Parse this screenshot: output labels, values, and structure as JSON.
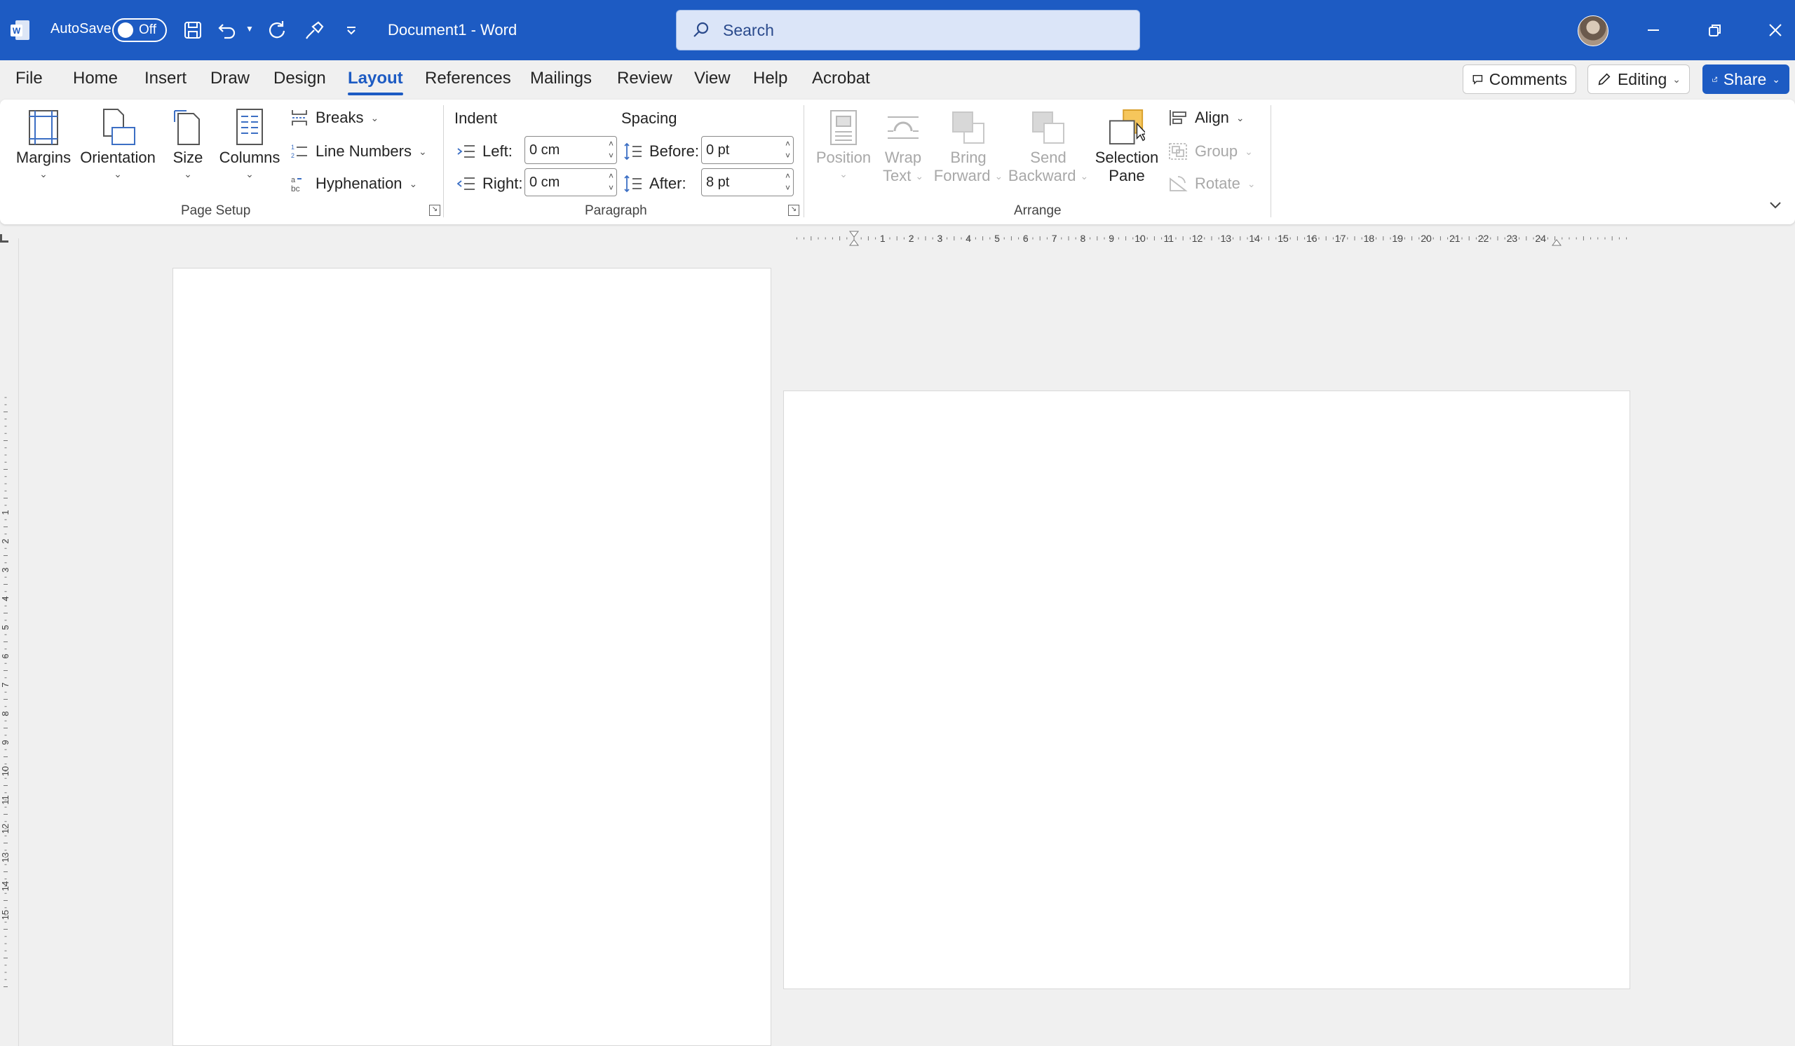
{
  "app": {
    "autosave_label": "AutoSave",
    "autosave_state": "Off",
    "document_title": "Document1  -  Word",
    "search_placeholder": "Search"
  },
  "tabs": [
    {
      "label": "File"
    },
    {
      "label": "Home"
    },
    {
      "label": "Insert"
    },
    {
      "label": "Draw"
    },
    {
      "label": "Design"
    },
    {
      "label": "Layout"
    },
    {
      "label": "References"
    },
    {
      "label": "Mailings"
    },
    {
      "label": "Review"
    },
    {
      "label": "View"
    },
    {
      "label": "Help"
    },
    {
      "label": "Acrobat"
    }
  ],
  "active_tab": "Layout",
  "header_buttons": {
    "comments": "Comments",
    "editing": "Editing",
    "share": "Share"
  },
  "ribbon": {
    "page_setup": {
      "label": "Page Setup",
      "margins": "Margins",
      "orientation": "Orientation",
      "size": "Size",
      "columns": "Columns",
      "breaks": "Breaks",
      "line_numbers": "Line Numbers",
      "hyphenation": "Hyphenation"
    },
    "paragraph": {
      "label": "Paragraph",
      "indent_heading": "Indent",
      "spacing_heading": "Spacing",
      "left_label": "Left:",
      "left_value": "0 cm",
      "right_label": "Right:",
      "right_value": "0 cm",
      "before_label": "Before:",
      "before_value": "0 pt",
      "after_label": "After:",
      "after_value": "8 pt"
    },
    "arrange": {
      "label": "Arrange",
      "position": "Position",
      "wrap_text_1": "Wrap",
      "wrap_text_2": "Text",
      "bring_forward_1": "Bring",
      "bring_forward_2": "Forward",
      "send_backward_1": "Send",
      "send_backward_2": "Backward",
      "selection_pane_1": "Selection",
      "selection_pane_2": "Pane",
      "align": "Align",
      "group": "Group",
      "rotate": "Rotate"
    }
  },
  "ruler": {
    "numbers": [
      "1",
      "2",
      "3",
      "4",
      "5",
      "6",
      "7",
      "8",
      "9",
      "10",
      "11",
      "12",
      "13",
      "14",
      "15",
      "16",
      "17",
      "18",
      "19",
      "20",
      "21",
      "22",
      "23",
      "24"
    ],
    "vertical_numbers": [
      "1",
      "2",
      "3",
      "4",
      "5",
      "6",
      "7",
      "8",
      "9",
      "10",
      "11",
      "12",
      "13",
      "14",
      "15"
    ]
  },
  "colors": {
    "titlebar": "#1d5bc3",
    "accent": "#1d5bc3",
    "canvas": "#f0f0f0"
  }
}
